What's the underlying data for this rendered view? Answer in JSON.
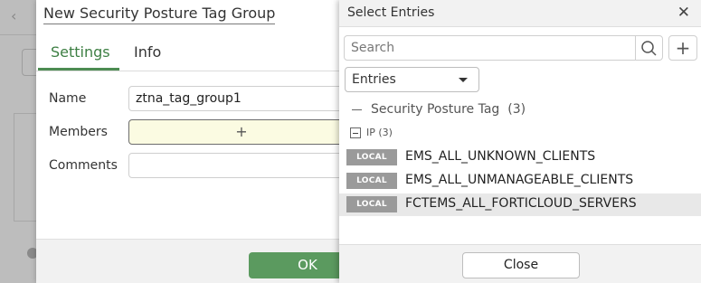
{
  "dialog": {
    "title": "New Security Posture Tag Group",
    "tabs": [
      "Settings",
      "Info"
    ],
    "active_tab": "Settings",
    "fields": {
      "name_label": "Name",
      "name_value": "ztna_tag_group1",
      "members_label": "Members",
      "members_add_glyph": "+",
      "comments_label": "Comments",
      "comments_value": ""
    },
    "ok_label": "OK"
  },
  "panel": {
    "title": "Select Entries",
    "close_glyph": "✕",
    "search_placeholder": "Search",
    "add_glyph": "+",
    "dropdown_value": "Entries",
    "group_label": "Security Posture Tag",
    "group_count": "(3)",
    "subgroup_label": "IP",
    "subgroup_count": "(3)",
    "entries": [
      {
        "badge": "LOCAL",
        "label": "EMS_ALL_UNKNOWN_CLIENTS",
        "selected": false
      },
      {
        "badge": "LOCAL",
        "label": "EMS_ALL_UNMANAGEABLE_CLIENTS",
        "selected": false
      },
      {
        "badge": "LOCAL",
        "label": "FCTEMS_ALL_FORTICLOUD_SERVERS",
        "selected": true
      }
    ],
    "close_label": "Close"
  },
  "colors": {
    "accent_green": "#4c8c52",
    "ok_button": "#5b9a5f",
    "badge_gray": "#9a9a9a",
    "members_highlight": "#fbfbe2"
  },
  "icons": {
    "search": "search-icon",
    "close": "close-icon",
    "add": "plus-icon",
    "dropdown": "caret-down-icon",
    "collapse": "collapse-icon"
  }
}
